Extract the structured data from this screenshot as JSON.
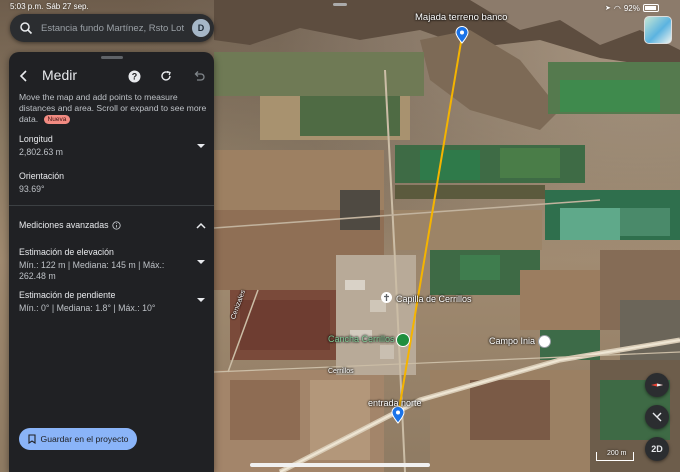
{
  "status_bar": {
    "time": "5:03 p.m.",
    "date": "Sáb 27 sep.",
    "battery": "92%"
  },
  "search": {
    "placeholder": "Estancia fundo Martínez, Rsto Lot",
    "avatar_initial": "D"
  },
  "panel": {
    "title": "Medir",
    "description": "Move the map and add points to measure distances and area. Scroll or expand to see more data.",
    "new_badge": "Nueva",
    "length_label": "Longitud",
    "length_value": "2,802.63 m",
    "orientation_label": "Orientación",
    "orientation_value": "93.69°",
    "advanced_label": "Mediciones avanzadas",
    "elevation_label": "Estimación de elevación",
    "elevation_value": "Mín.: 122 m | Mediana: 145 m | Máx.: 262.48 m",
    "slope_label": "Estimación de pendiente",
    "slope_value": "Mín.: 0° | Mediana: 1.8° | Máx.: 10°",
    "save_button": "Guardar en el proyecto"
  },
  "map": {
    "label_start": "Majada terreno banco",
    "label_chapel": "Capilla de Cerrillos",
    "label_court": "Cancha Cerrillos",
    "label_campo": "Campo Inia",
    "label_end": "entrada norte",
    "label_road": "Cenizales",
    "label_bottom": "Cerrillos",
    "scale_label": "200 m",
    "view_mode": "2D"
  },
  "colors": {
    "accent": "#8ab4f8",
    "measure_line": "#f5b400",
    "pin": "#1a73e8",
    "panel_bg": "#202124"
  }
}
